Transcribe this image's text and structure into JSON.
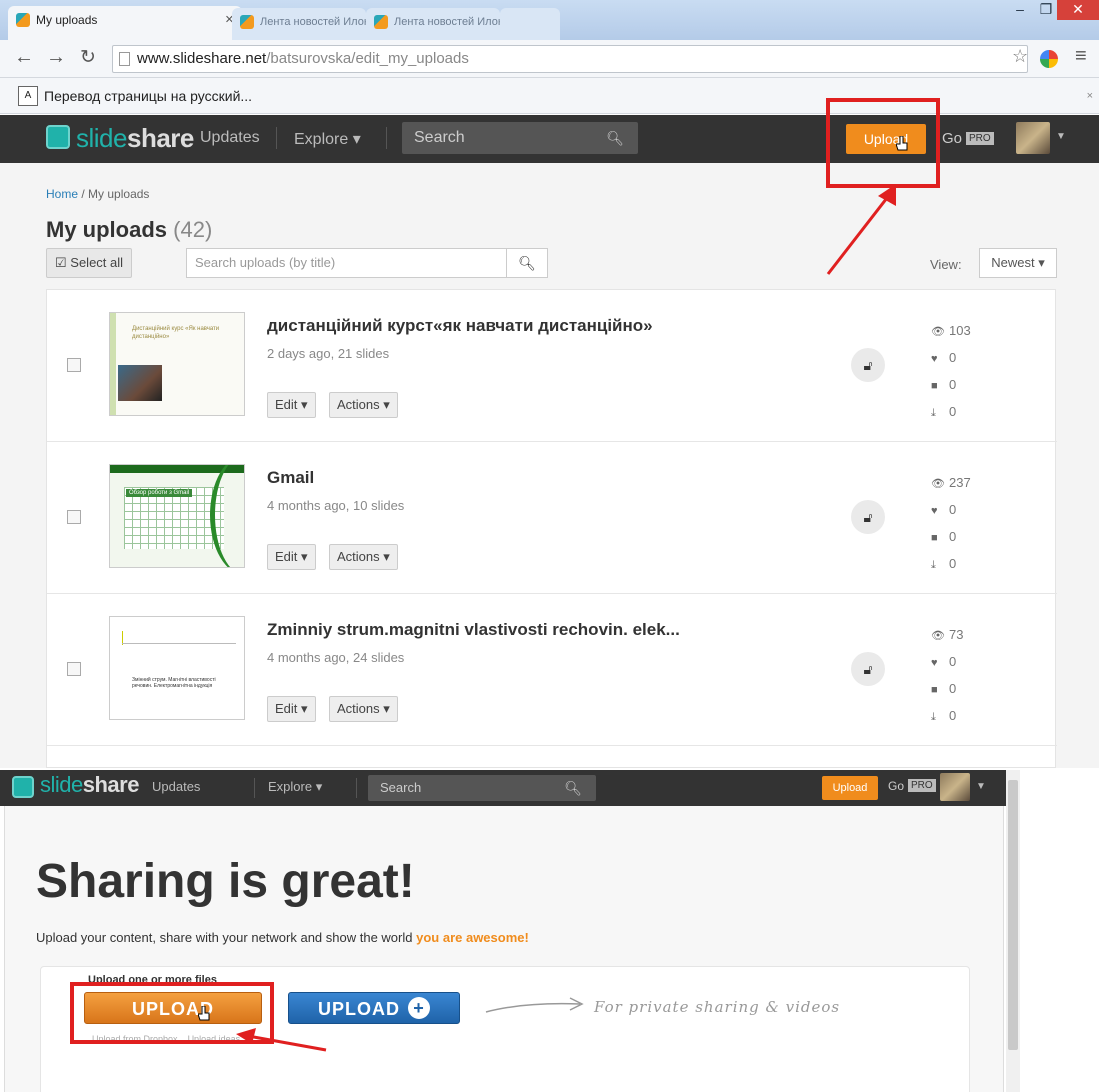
{
  "browser": {
    "tabs": [
      {
        "title": "My uploads",
        "active": true
      },
      {
        "title": "Лента новостей Илона Е",
        "active": false
      },
      {
        "title": "Лента новостей Илона Е",
        "active": false
      }
    ],
    "url_host": "www.slideshare.net",
    "url_path": "/batsurovska/edit_my_uploads",
    "translate_text": "Перевод страницы на русский..."
  },
  "header": {
    "logo_light": "slide",
    "logo_bold": "share",
    "updates": "Updates",
    "explore": "Explore",
    "search_placeholder": "Search",
    "upload": "Upload",
    "go": "Go",
    "pro": "PRO"
  },
  "uploads": {
    "breadcrumb_home": "Home",
    "breadcrumb_sep": "/",
    "breadcrumb_current": "My uploads",
    "title": "My uploads",
    "count": "(42)",
    "select_all": "Select all",
    "search_placeholder": "Search uploads (by title)",
    "view_label": "View:",
    "sort": "Newest",
    "edit_label": "Edit",
    "actions_label": "Actions",
    "items": [
      {
        "title": "дистанційний курст«як навчати дистанційно»",
        "meta": "2 days ago, 21 slides",
        "views": "103",
        "likes": "0",
        "comments": "0",
        "downloads": "0",
        "thumb_title": "Дистанційний курс «Як навчати дистанційно»"
      },
      {
        "title": "Gmail",
        "meta": "4 months ago, 10 slides",
        "views": "237",
        "likes": "0",
        "comments": "0",
        "downloads": "0",
        "thumb_title": "Обзор роботи з Gmail"
      },
      {
        "title": "Zminniy strum.magnitni vlastivosti rechovin. elek...",
        "meta": "4 months ago, 24 slides",
        "views": "73",
        "likes": "0",
        "comments": "0",
        "downloads": "0",
        "thumb_title": "Змінний струм. Магнітні властивості речовин. Електромагнітна індукція"
      }
    ]
  },
  "upload_page": {
    "hero": "Sharing is great!",
    "sub_text": "Upload your content, share with your network and show the world",
    "sub_accent": "you are awesome!",
    "upload_one": "Upload one or more files",
    "upload_button": "UPLOAD",
    "upload_private_button": "UPLOAD",
    "private_note": "For private sharing & videos",
    "dropbox_link": "Upload from Dropbox",
    "ideas_link": "Upload ideas"
  },
  "colors": {
    "accent_orange": "#f08c1d",
    "header_dark": "#333333",
    "brand_teal": "#20b2aa",
    "annotation_red": "#e02020"
  }
}
